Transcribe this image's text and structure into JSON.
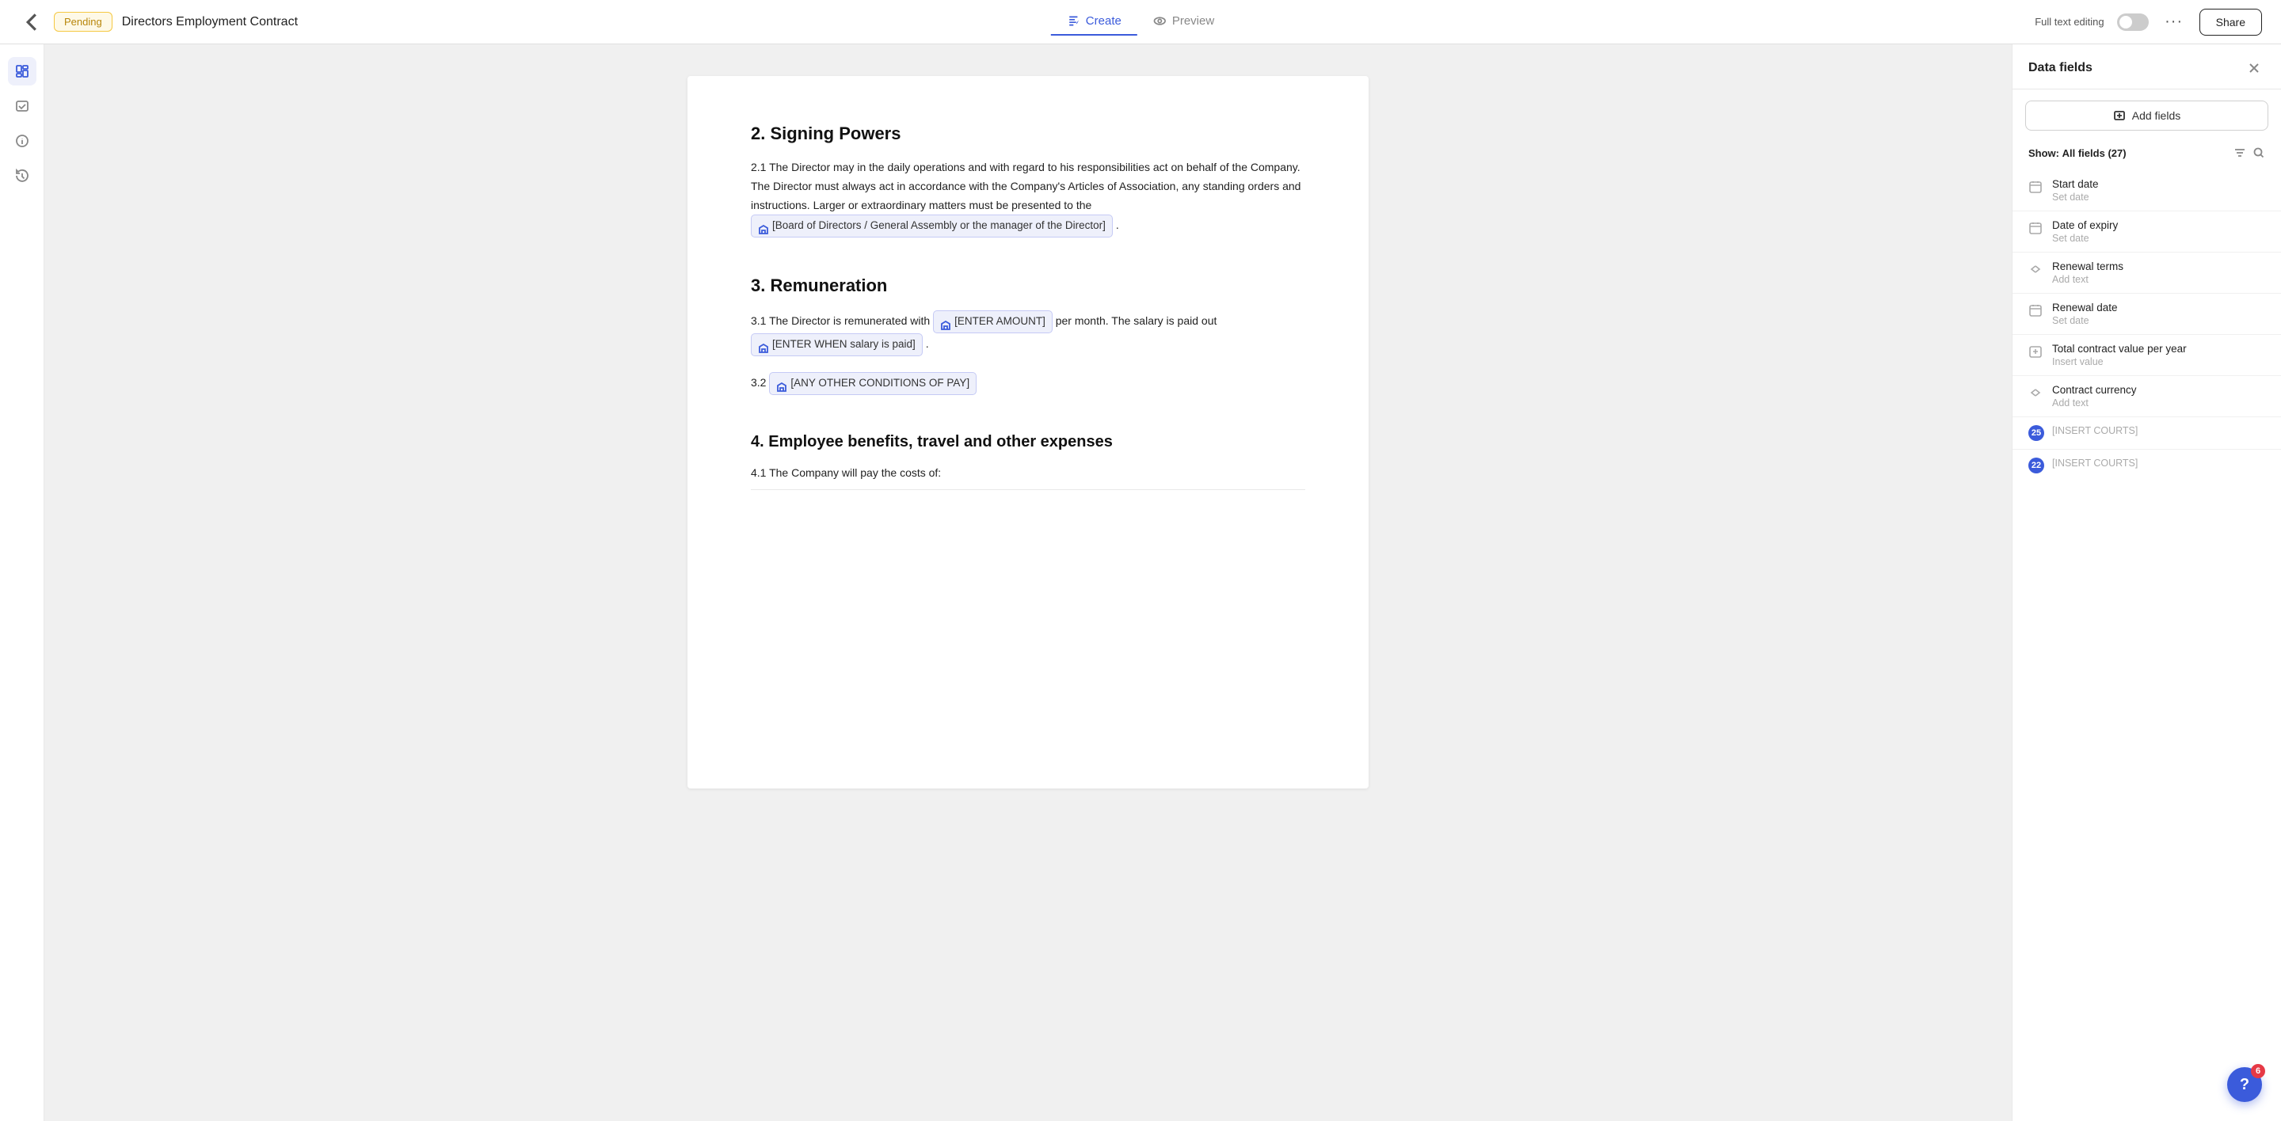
{
  "topbar": {
    "back_btn_label": "←",
    "status": "Pending",
    "doc_title": "Directors Employment Contract",
    "create_tab": "Create",
    "preview_tab": "Preview",
    "full_text_label": "Full text editing",
    "toggle_on": false,
    "more_label": "···",
    "share_label": "Share"
  },
  "sidebar_icons": [
    "layout-icon",
    "check-icon",
    "info-icon",
    "history-icon"
  ],
  "document": {
    "section2_title": "2. Signing Powers",
    "section2_body": "2.1 The Director may in the daily operations and with regard to his responsibilities act on behalf of the Company. The Director must always act in accordance with the Company's Articles of Association, any standing orders and instructions. Larger or extraordinary matters must be presented to the",
    "section2_field": "[Board of Directors / General Assembly or the manager of the Director]",
    "section2_field_suffix": ".",
    "section3_title": "3. Remuneration",
    "section3_body": "3.1 The Director is remunerated with",
    "section3_field1": "[ENTER AMOUNT]",
    "section3_mid": "per month. The salary is paid out",
    "section3_field2": "[ENTER WHEN salary is paid]",
    "section3_suffix": ".",
    "section3_2": "3.2",
    "section3_field3": "[ANY OTHER CONDITIONS OF PAY]",
    "section4_title": "4. Employee benefits, travel and other expenses",
    "section4_body": "4.1 The Company will pay the costs of:"
  },
  "panel": {
    "title": "Data fields",
    "add_fields_label": "Add fields",
    "show_label": "Show:",
    "all_fields_label": "All fields",
    "count": "(27)",
    "fields": [
      {
        "id": "start-date",
        "name": "Start date",
        "value": "Set date",
        "icon": "calendar",
        "badge": null,
        "color": "gray"
      },
      {
        "id": "date-of-expiry",
        "name": "Date of expiry",
        "value": "Set date",
        "icon": "calendar",
        "badge": null,
        "color": "gray"
      },
      {
        "id": "renewal-terms",
        "name": "Renewal terms",
        "value": "Add text",
        "icon": "field",
        "badge": null,
        "color": "gray"
      },
      {
        "id": "renewal-date",
        "name": "Renewal date",
        "value": "Set date",
        "icon": "calendar",
        "badge": null,
        "color": "gray"
      },
      {
        "id": "total-contract-value",
        "name": "Total contract value per year",
        "value": "Insert value",
        "icon": "number",
        "badge": null,
        "color": "gray"
      },
      {
        "id": "contract-currency",
        "name": "Contract currency",
        "value": "Add text",
        "icon": "field",
        "badge": null,
        "color": "gray"
      },
      {
        "id": "insert-courts-25",
        "name": "25",
        "value": "[INSERT COURTS]",
        "icon": "badge",
        "badge": "25",
        "color": "blue"
      },
      {
        "id": "insert-courts-22",
        "name": "22",
        "value": "[INSERT COURTS]",
        "icon": "badge",
        "badge": "22",
        "color": "blue"
      }
    ]
  },
  "help": {
    "badge_count": "6",
    "label": "?"
  }
}
